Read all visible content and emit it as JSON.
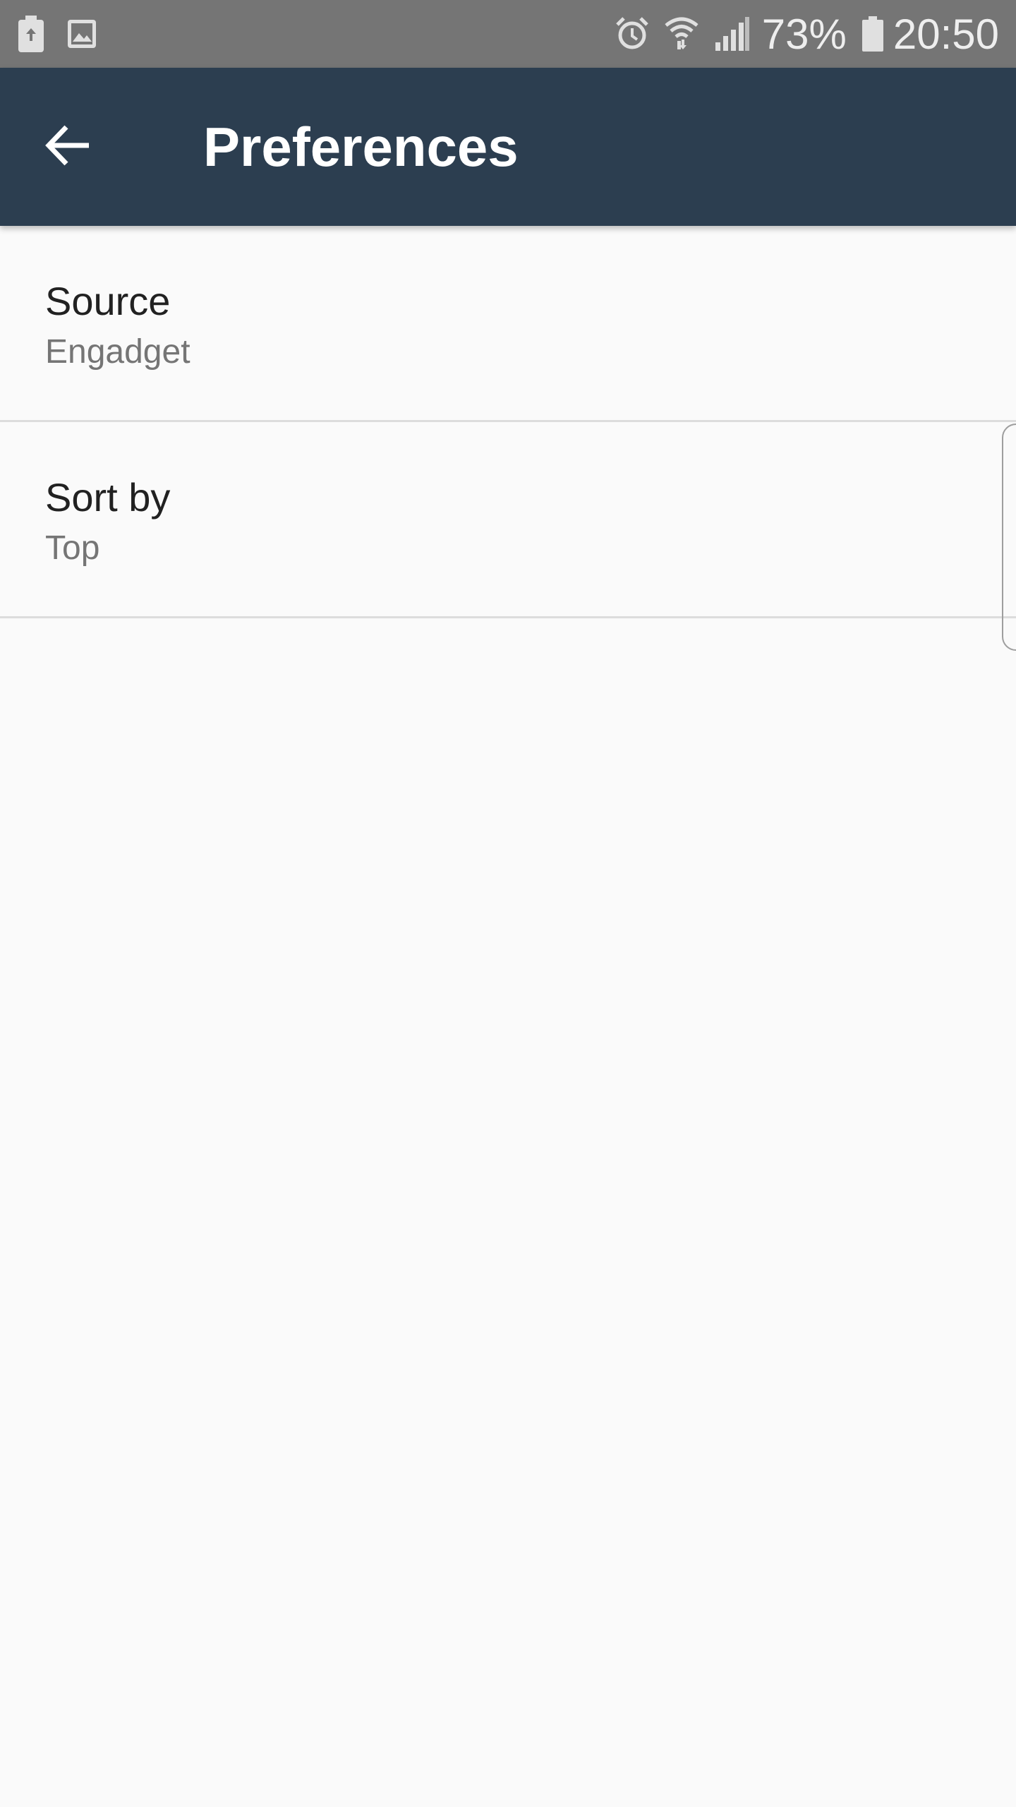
{
  "status_bar": {
    "left_icons": [
      "battery-saver-icon",
      "image-icon"
    ],
    "right_icons": [
      "alarm-icon",
      "wifi-icon",
      "signal-icon",
      "battery-icon"
    ],
    "battery_percent": "73%",
    "time": "20:50"
  },
  "app_bar": {
    "title": "Preferences",
    "back_icon": "arrow-back-icon"
  },
  "preferences": [
    {
      "title": "Source",
      "summary": "Engadget"
    },
    {
      "title": "Sort by",
      "summary": "Top"
    }
  ],
  "colors": {
    "status_bar": "#757575",
    "app_bar": "#2c3e50",
    "background": "#fafafa"
  }
}
